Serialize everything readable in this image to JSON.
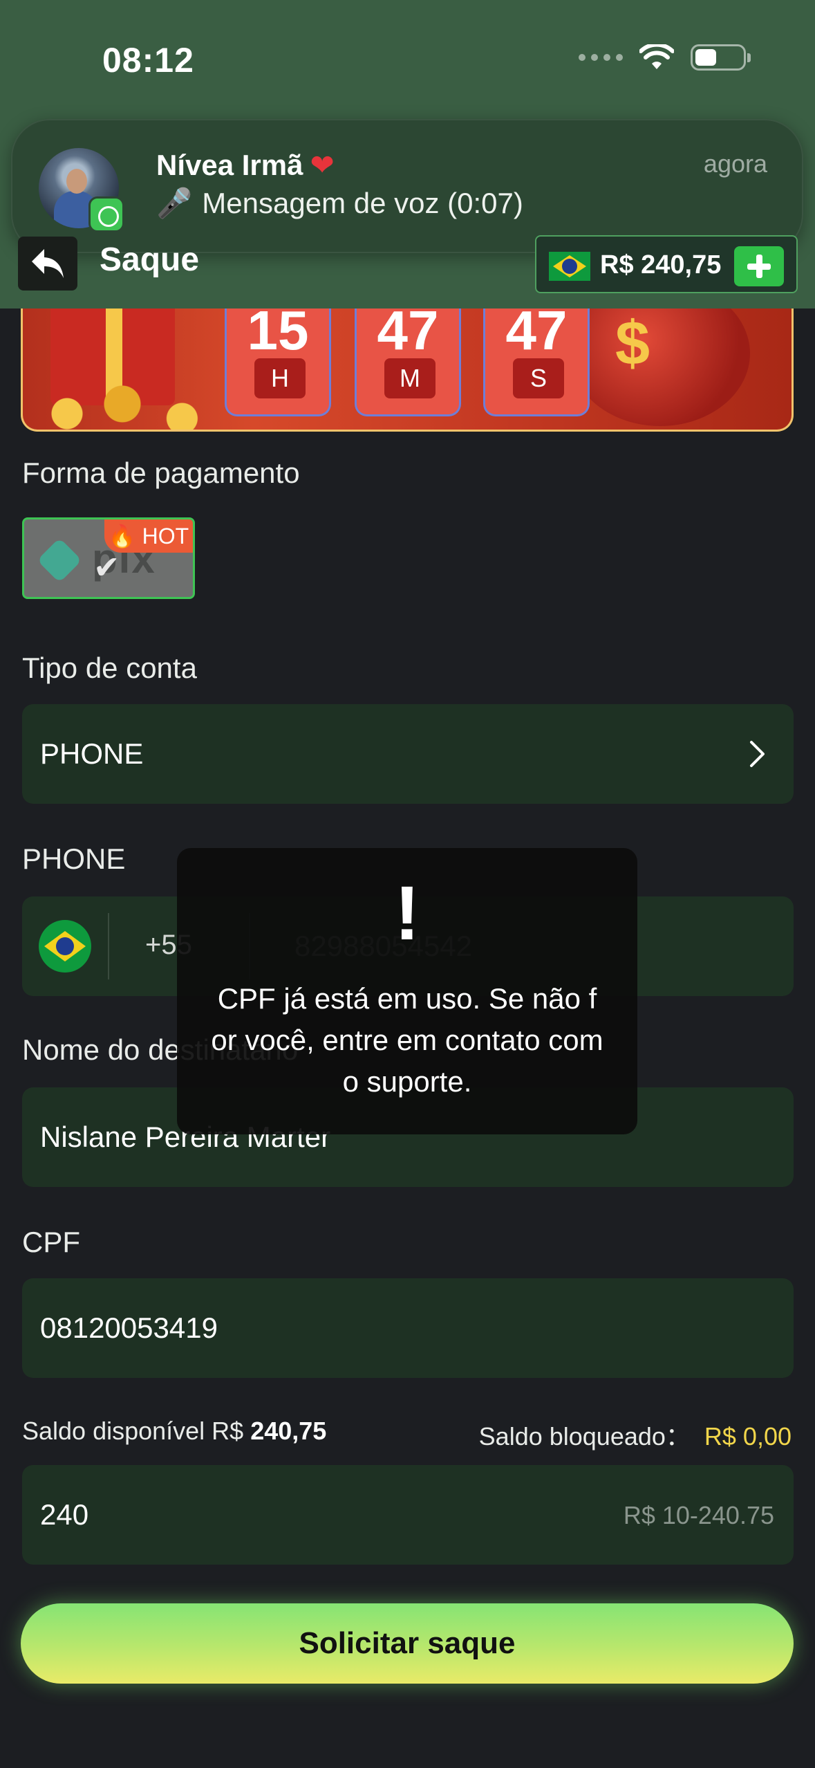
{
  "status_bar": {
    "time": "08:12"
  },
  "notification": {
    "sender": "Nívea Irmã",
    "heart": "❤",
    "message": "Mensagem de voz (0:07)",
    "time": "agora",
    "app_icon": "whatsapp-icon"
  },
  "header": {
    "title": "Saque",
    "balance": "R$ 240,75",
    "back_icon": "back-arrow-icon",
    "add_icon": "plus-icon"
  },
  "banner": {
    "timers": [
      {
        "value": "15",
        "unit": "H"
      },
      {
        "value": "47",
        "unit": "M"
      },
      {
        "value": "47",
        "unit": "S"
      }
    ]
  },
  "form": {
    "payment_label": "Forma de pagamento",
    "payment_method": {
      "name": "pix",
      "tag": "HOT"
    },
    "account_type_label": "Tipo de conta",
    "account_type_value": "PHONE",
    "phone_label": "PHONE",
    "phone_code": "+55",
    "phone_value": "82988054542",
    "recipient_label": "Nome do destinatário",
    "recipient_value": "Nislane Pereira Marter",
    "cpf_label": "CPF",
    "cpf_value": "08120053419",
    "saldo_disponivel_label": "Saldo disponível R$",
    "saldo_disponivel_value": "240,75",
    "saldo_bloqueado_label": "Saldo bloqueado：",
    "saldo_bloqueado_value": "R$ 0,00",
    "amount_value": "240",
    "amount_range": "R$ 10-240.75",
    "submit_label": "Solicitar saque"
  },
  "toast": {
    "icon": "!",
    "message": "CPF já está em uso. Se não for você, entre em contato com o suporte."
  },
  "colors": {
    "header_bg": "#3a5e43",
    "page_bg": "#1c1e22",
    "field_bg": "#1e3123",
    "accent_green": "#3ec454",
    "blocked_yellow": "#f2d64b"
  }
}
